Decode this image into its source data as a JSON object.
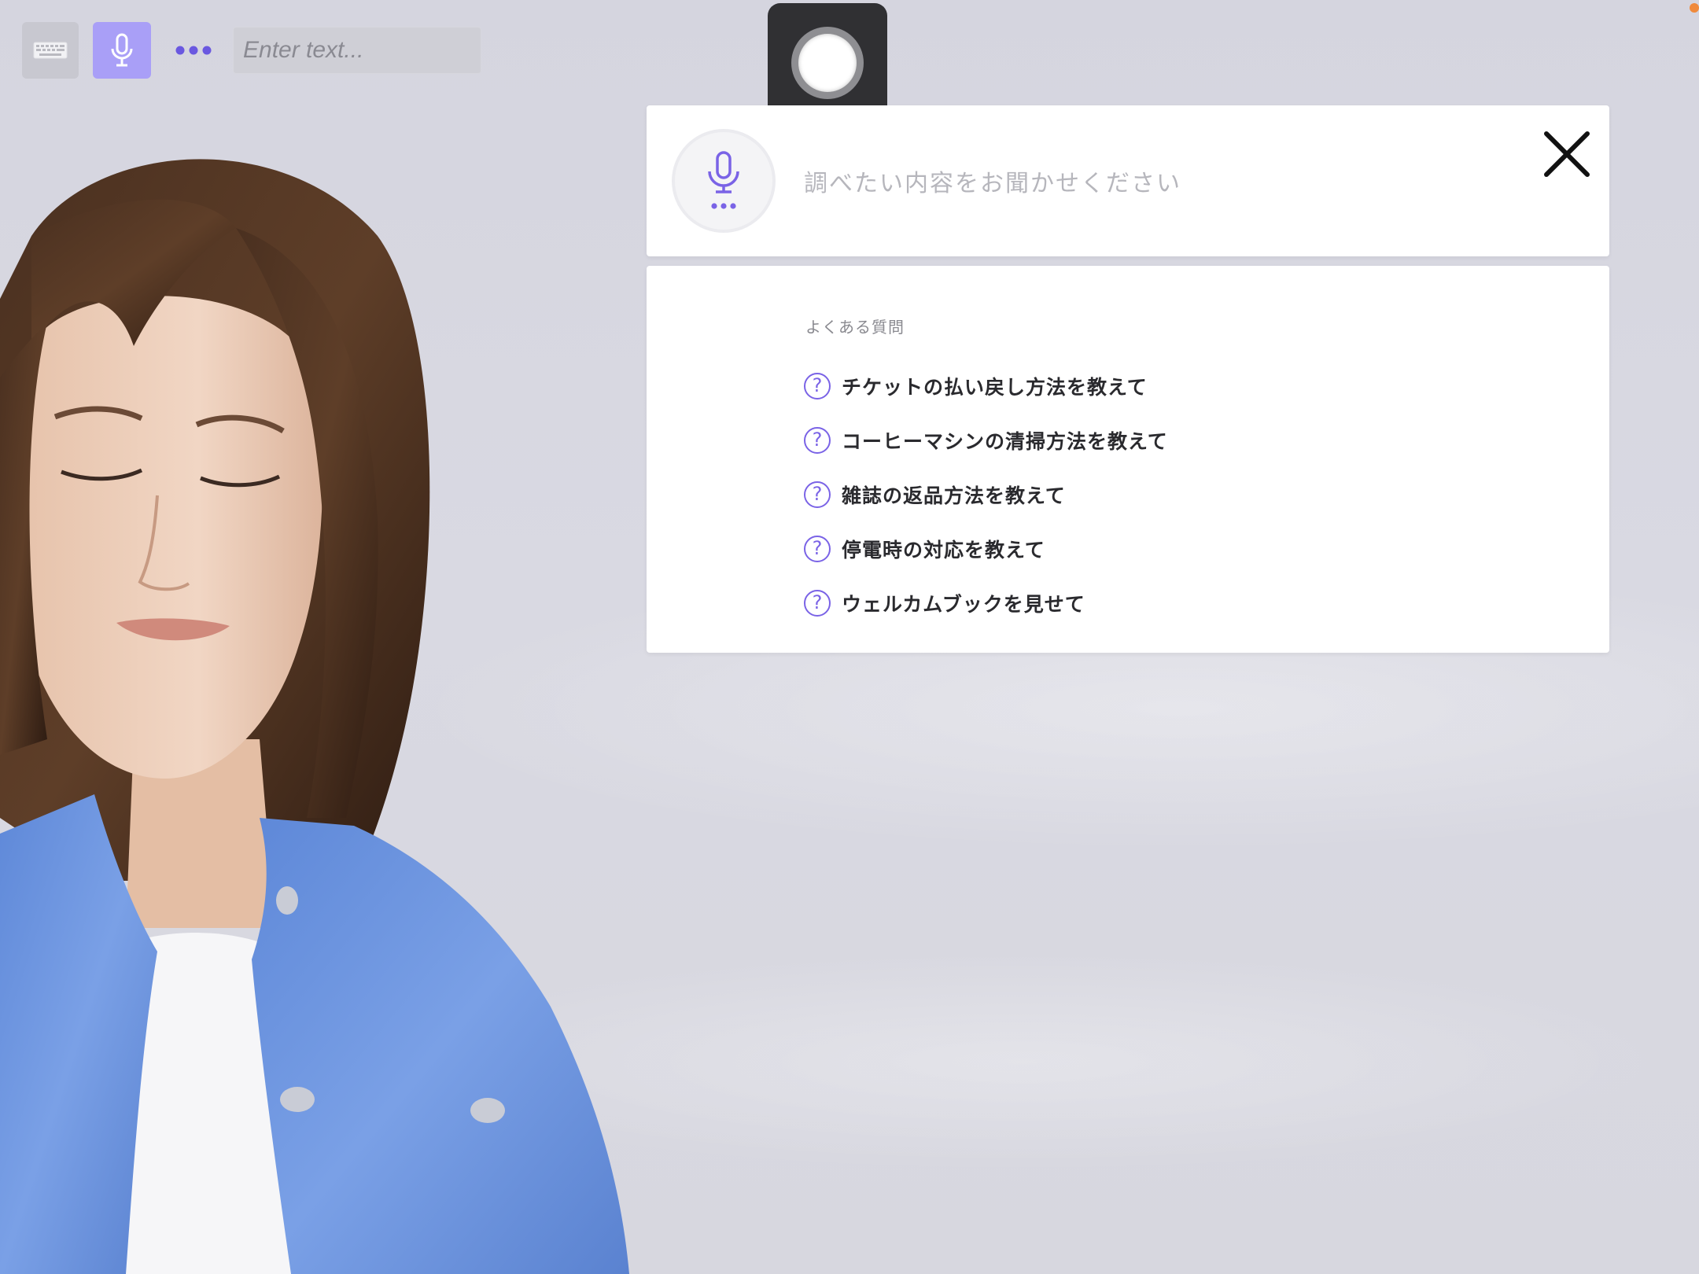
{
  "toolbar": {
    "keyboard_icon": "keyboard-icon",
    "mic_icon": "microphone-icon",
    "more_icon": "more-dots-icon",
    "input_placeholder": "Enter text...",
    "input_value": ""
  },
  "record": {
    "icon": "record-icon"
  },
  "voice_search": {
    "prompt": "調べたい内容をお聞かせください",
    "mic_icon": "microphone-listening-icon",
    "close_icon": "close-icon"
  },
  "faq": {
    "title": "よくある質問",
    "items": [
      {
        "icon": "question-icon",
        "label": "チケットの払い戻し方法を教えて"
      },
      {
        "icon": "question-icon",
        "label": "コーヒーマシンの清掃方法を教えて"
      },
      {
        "icon": "question-icon",
        "label": "雑誌の返品方法を教えて"
      },
      {
        "icon": "question-icon",
        "label": "停電時の対応を教えて"
      },
      {
        "icon": "question-icon",
        "label": "ウェルカムブックを見せて"
      }
    ]
  },
  "colors": {
    "accent": "#7a63e6",
    "mic_button": "#a99ff7",
    "record_button": "#303033",
    "panel_bg": "#ffffff",
    "backdrop": "#d7d7df",
    "jacket": "#6f97e0"
  }
}
